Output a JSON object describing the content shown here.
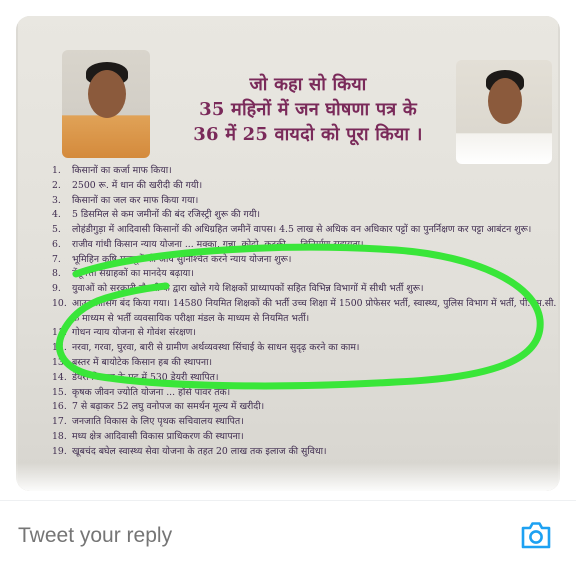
{
  "tweet_image": {
    "headline": [
      "जो कहा सो किया",
      "35 महिनों में जन घोषणा पत्र के",
      "36 में 25 वायदो को पूरा किया ।"
    ],
    "items": [
      {
        "n": "1.",
        "t": "किसानों का कर्जा माफ किया।"
      },
      {
        "n": "2.",
        "t": "2500 रू. में धान की खरीदी की गयी।"
      },
      {
        "n": "3.",
        "t": "किसानों का जल कर माफ किया गया।"
      },
      {
        "n": "4.",
        "t": "5 डिसमिल से कम जमीनों की बंद रजिस्ट्री शुरू की गयी।"
      },
      {
        "n": "5.",
        "t": "लोहंडीगुड़ा में आदिवासी किसानों की अधिग्रहित जमीनें वापस। 4.5 लाख से अधिक वन अधिकार पट्टों का पुनर्निक्षण कर पट्टा आबंटन शुरू।"
      },
      {
        "n": "6.",
        "t": "राजीव गांधी किसान न्याय योजना ... मक्का, गन्ना, कोदो, कुटकी ... विनिर्माण सहायता।"
      },
      {
        "n": "7.",
        "t": "भूमिहिन कृषि मजदूरों की आय सुनिश्चित करने न्याय योजना शुरू।"
      },
      {
        "n": "8.",
        "t": "तेंदूपत्ता संग्राहकों का मानदेय बढ़ाया।"
      },
      {
        "n": "9.",
        "t": "युवाओं को सरकारी नौकरी के द्वारा खोले गये शिक्षकों प्राध्यापकों सहित विभिन्न विभागों में सीधी भर्ती शुरू।"
      },
      {
        "n": "10.",
        "t": "आउट सोर्सिंग बंद किया गया। 14580 नियमित शिक्षकों की भर्ती उच्च शिक्षा में 1500 प्रोफेसर भर्ती, स्वास्थ्य, पुलिस विभाग में भर्ती, पी.एस.सी. के माध्यम से भर्ती व्यवसायिक परीक्षा मंडल के माध्यम से नियमित भर्ती।"
      },
      {
        "n": "11.",
        "t": "गोधन न्याय योजना से गोवंश संरक्षण।"
      },
      {
        "n": "12.",
        "t": "नरवा, गरवा, घुरवा, बारी से ग्रामीण अर्थव्यवस्था सिंचाई के साधन सुदृढ़ करने का काम।"
      },
      {
        "n": "13.",
        "t": "बस्तर में बायोटेक किसान हब की स्थापना।"
      },
      {
        "n": "14.",
        "t": "डेयरी विकास के मद में 530 डेयरी स्थापित।"
      },
      {
        "n": "15.",
        "t": "कृषक जीवन ज्योति योजना ... हॉर्स पावर तक।"
      },
      {
        "n": "16.",
        "t": "7 से बढ़ाकर 52 लघु वनोपज का समर्थन मूल्य में खरीदी।"
      },
      {
        "n": "17.",
        "t": "जनजाति विकास के लिए पृथक सचिवालय स्थापित।"
      },
      {
        "n": "18.",
        "t": "मध्य क्षेत्र आदिवासी विकास प्राधिकरण की स्थापना।"
      },
      {
        "n": "19.",
        "t": "खूबचंद बघेल स्वास्थ्य सेवा योजना के तहत 20 लाख तक इलाज की सुविधा।"
      }
    ],
    "highlight_color": "#39e639"
  },
  "reply": {
    "placeholder": "Tweet your reply",
    "camera_icon": "camera-icon",
    "accent_color": "#1da1f2"
  }
}
